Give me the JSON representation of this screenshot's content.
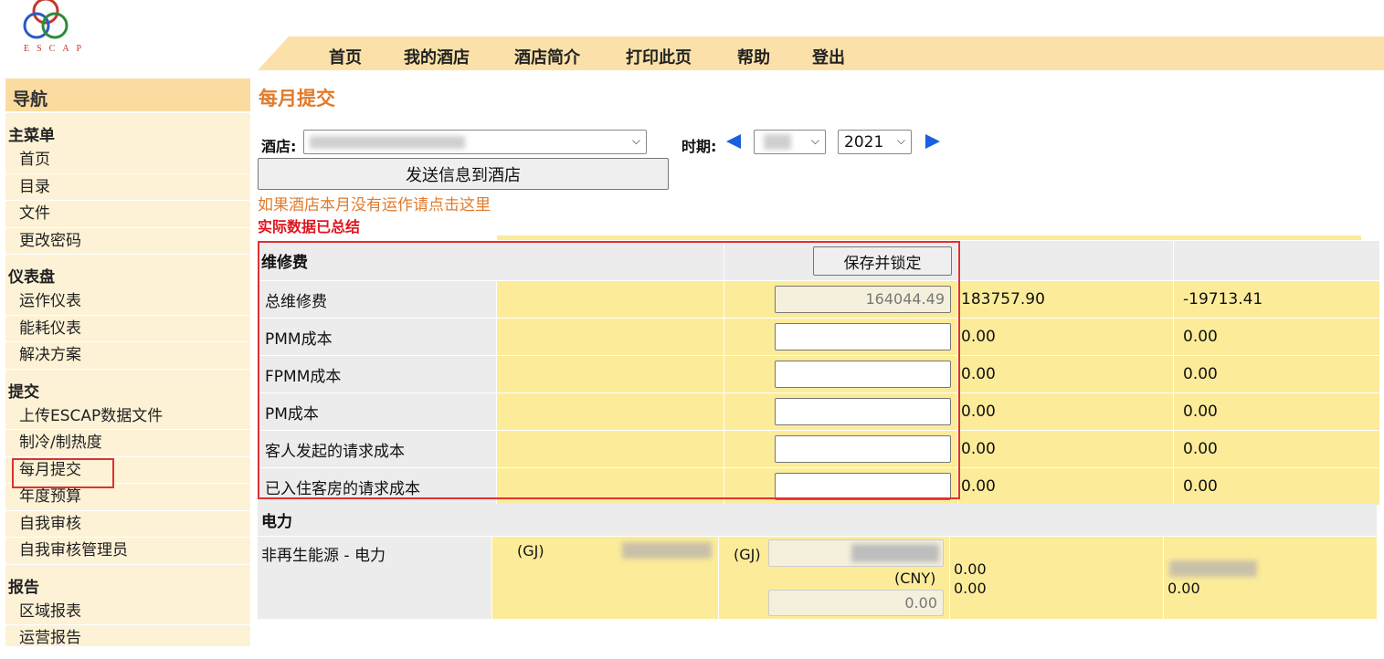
{
  "logo": {
    "text": "ESCAP"
  },
  "topmenu": {
    "items": [
      "首页",
      "我的酒店",
      "酒店简介",
      "打印此页",
      "帮助",
      "登出"
    ]
  },
  "sidebar": {
    "header": "导航",
    "sections": [
      {
        "title": "主菜单",
        "items": [
          "首页",
          "目录",
          "文件",
          "更改密码"
        ]
      },
      {
        "title": "仪表盘",
        "items": [
          "运作仪表",
          "能耗仪表",
          "解决方案"
        ]
      },
      {
        "title": "提交",
        "items": [
          "上传ESCAP数据文件",
          "制冷/制热度",
          "每月提交",
          "年度预算",
          "自我审核",
          "自我审核管理员"
        ]
      },
      {
        "title": "报告",
        "items": [
          "区域报表",
          "运营报告"
        ]
      }
    ],
    "active_item": "每月提交"
  },
  "main": {
    "title": "每月提交",
    "hotel_label": "酒店:",
    "period_label": "时期:",
    "year_value": "2021",
    "send_button": "发送信息到酒店",
    "notice_link": "如果酒店本月没有运作请点击这里",
    "notice_red": "实际数据已总结"
  },
  "maintenance": {
    "section_title": "维修费",
    "save_button": "保存并锁定",
    "rows": [
      {
        "label": "总维修费",
        "input": "164044.49",
        "col3": "183757.90",
        "col4": "-19713.41"
      },
      {
        "label": "PMM成本",
        "input": "",
        "col3": "0.00",
        "col4": "0.00"
      },
      {
        "label": "FPMM成本",
        "input": "",
        "col3": "0.00",
        "col4": "0.00"
      },
      {
        "label": "PM成本",
        "input": "",
        "col3": "0.00",
        "col4": "0.00"
      },
      {
        "label": "客人发起的请求成本",
        "input": "",
        "col3": "0.00",
        "col4": "0.00"
      },
      {
        "label": "已入住客房的请求成本",
        "input": "",
        "col3": "0.00",
        "col4": "0.00"
      }
    ]
  },
  "electricity": {
    "section_title": "电力",
    "row_label": "非再生能源 - 电力",
    "unit_gj_1": "(GJ)",
    "unit_gj_2": "(GJ)",
    "unit_cny": "(CNY)",
    "cny_value": "0.00",
    "col3_line1": "0.00",
    "col3_line2": "0.00",
    "col4_value": "0.00"
  },
  "colors": {
    "menu_bg": "#fbe1a9",
    "title_orange": "#e07b2c",
    "highlight_red": "#e03131",
    "row_yellow": "#fcec9a",
    "arrow_blue": "#1a5fe0"
  }
}
